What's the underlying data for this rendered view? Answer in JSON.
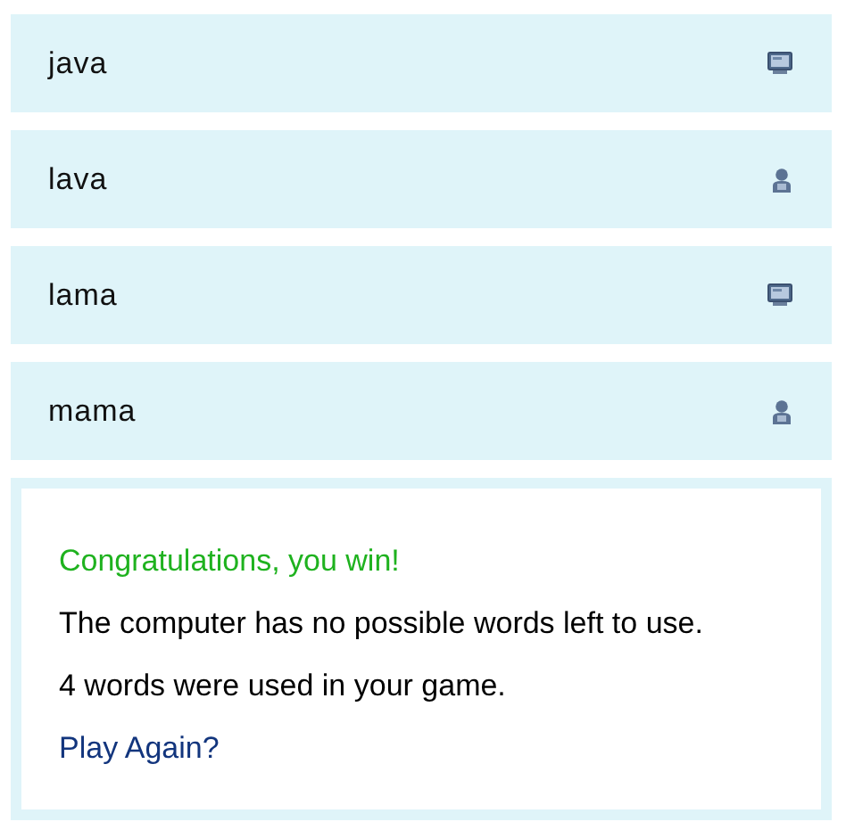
{
  "moves": [
    {
      "word": "java",
      "kind": "computer"
    },
    {
      "word": "lava",
      "kind": "person"
    },
    {
      "word": "lama",
      "kind": "computer"
    },
    {
      "word": "mama",
      "kind": "person"
    }
  ],
  "result": {
    "headline": "Congratulations, you win!",
    "reason": "The computer has no possible words left to use.",
    "summary": "4 words were used in your game.",
    "link": "Play Again?"
  }
}
